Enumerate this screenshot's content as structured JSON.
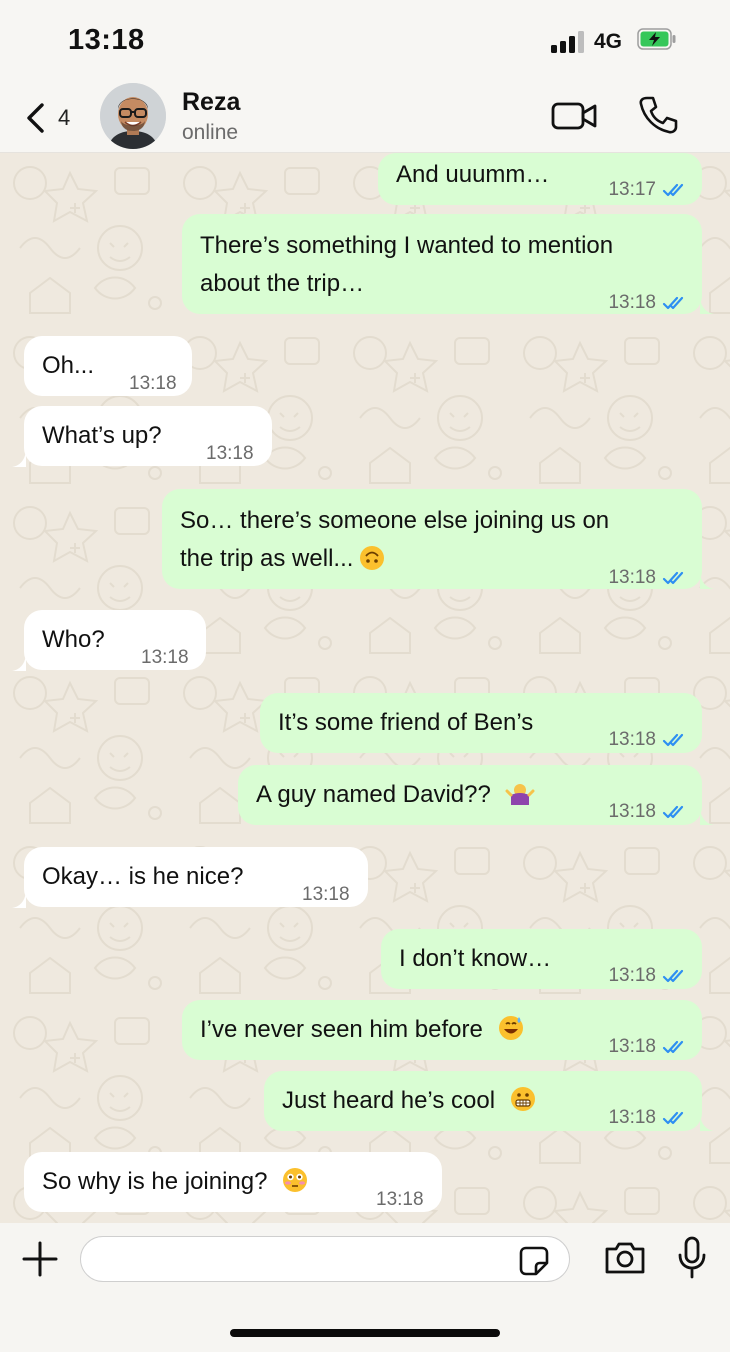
{
  "status_bar": {
    "time": "13:18",
    "network": "4G"
  },
  "header": {
    "back_count": "4",
    "contact_name": "Reza",
    "contact_status": "online"
  },
  "messages": [
    {
      "direction": "outgoing",
      "text": "And uuumm…",
      "time": "13:17",
      "read": true
    },
    {
      "direction": "outgoing",
      "text": "There’s something I wanted to mention\nabout the trip…",
      "time": "13:18",
      "read": true
    },
    {
      "direction": "incoming",
      "text": "Oh...",
      "time": "13:18"
    },
    {
      "direction": "incoming",
      "text": "What’s up?",
      "time": "13:18"
    },
    {
      "direction": "outgoing",
      "text": "So… there’s someone else joining us on\nthe trip as well...",
      "emoji": "upside-down-face",
      "time": "13:18",
      "read": true
    },
    {
      "direction": "incoming",
      "text": "Who?",
      "time": "13:18"
    },
    {
      "direction": "outgoing",
      "text": "It’s some friend of Ben’s",
      "time": "13:18",
      "read": true
    },
    {
      "direction": "outgoing",
      "text": "A guy named David??",
      "emoji": "shrug",
      "time": "13:18",
      "read": true
    },
    {
      "direction": "incoming",
      "text": "Okay… is he nice?",
      "time": "13:18"
    },
    {
      "direction": "outgoing",
      "text": "I don’t know…",
      "time": "13:18",
      "read": true
    },
    {
      "direction": "outgoing",
      "text": "I’ve never seen him before",
      "emoji": "grinning-sweat",
      "time": "13:18",
      "read": true
    },
    {
      "direction": "outgoing",
      "text": "Just heard he’s cool",
      "emoji": "grimacing",
      "time": "13:18",
      "read": true
    },
    {
      "direction": "incoming",
      "text": "So why is he joining?",
      "emoji": "flushed",
      "time": "13:18"
    }
  ],
  "input": {
    "value": "",
    "placeholder": ""
  },
  "colors": {
    "outgoing_bubble": "#d9fdd3",
    "incoming_bubble": "#ffffff",
    "read_ticks": "#2e8ff2",
    "battery_fill": "#35c759"
  },
  "icons": {
    "back": "chevron-left-icon",
    "video": "video-camera-icon",
    "call": "phone-icon",
    "add": "plus-icon",
    "sticker": "sticker-icon",
    "camera": "camera-icon",
    "mic": "microphone-icon",
    "read": "double-check-icon"
  }
}
